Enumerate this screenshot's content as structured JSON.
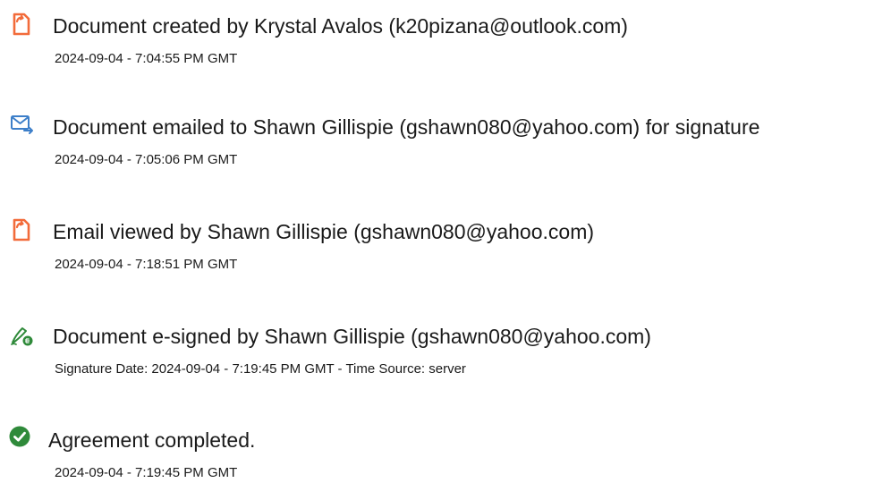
{
  "events": [
    {
      "icon": "document-icon",
      "title": "Document created by Krystal Avalos (k20pizana@outlook.com)",
      "detail": "2024-09-04 - 7:04:55 PM GMT"
    },
    {
      "icon": "email-send-icon",
      "title": "Document emailed to Shawn Gillispie (gshawn080@yahoo.com) for signature",
      "detail": "2024-09-04 - 7:05:06 PM GMT"
    },
    {
      "icon": "document-icon",
      "title": "Email viewed by Shawn Gillispie (gshawn080@yahoo.com)",
      "detail": "2024-09-04 - 7:18:51 PM GMT"
    },
    {
      "icon": "e-sign-pen-icon",
      "title": "Document e-signed by Shawn Gillispie (gshawn080@yahoo.com)",
      "detail": "Signature Date: 2024-09-04 - 7:19:45 PM GMT - Time Source: server"
    },
    {
      "icon": "checkmark-circle-icon",
      "title": "Agreement completed.",
      "detail": "2024-09-04 - 7:19:45 PM GMT"
    }
  ],
  "colors": {
    "document_icon": "#f26b3a",
    "email_icon": "#3d7fc9",
    "esign_icon": "#2f8a3a",
    "complete_icon": "#2f8a3a",
    "text": "#1a1a1a"
  }
}
